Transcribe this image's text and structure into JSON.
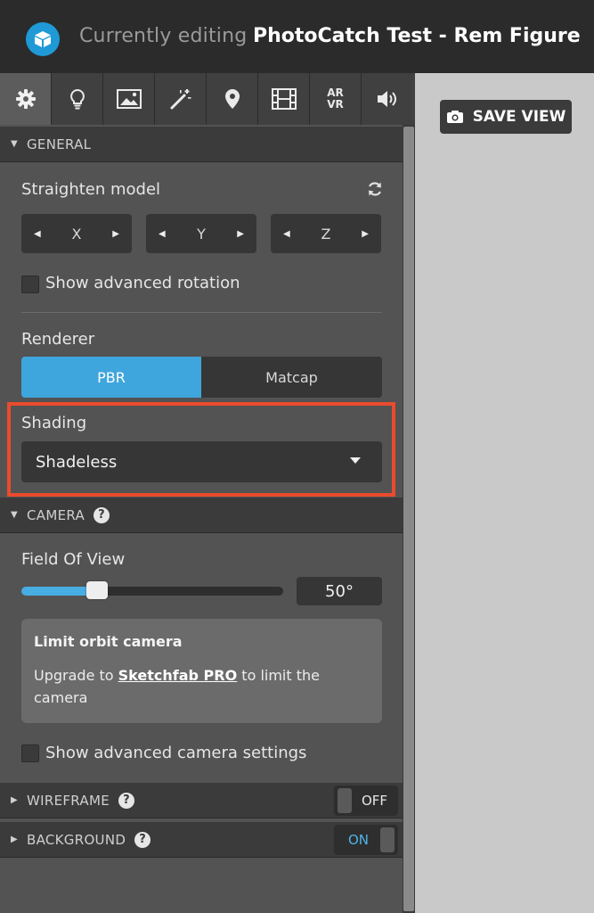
{
  "header": {
    "editing_label": "Currently editing",
    "model_title": "PhotoCatch Test - Rem Figure",
    "logo_icon": "cube-icon"
  },
  "tabs": [
    {
      "icon": "gear-icon",
      "active": true
    },
    {
      "icon": "lightbulb-icon"
    },
    {
      "icon": "image-icon"
    },
    {
      "icon": "magic-wand-icon"
    },
    {
      "icon": "map-pin-icon"
    },
    {
      "icon": "film-icon"
    },
    {
      "label_top": "AR",
      "label_bottom": "VR"
    },
    {
      "icon": "speaker-icon"
    }
  ],
  "general": {
    "section_label": "GENERAL",
    "straighten_label": "Straighten model",
    "axes": [
      "X",
      "Y",
      "Z"
    ],
    "advanced_rotation_label": "Show advanced rotation",
    "renderer_label": "Renderer",
    "renderer_options": [
      "PBR",
      "Matcap"
    ],
    "renderer_selected": "PBR",
    "shading_label": "Shading",
    "shading_value": "Shadeless"
  },
  "camera": {
    "section_label": "CAMERA",
    "fov_label": "Field Of View",
    "fov_value": "50°",
    "fov_slider_fraction": 0.29,
    "orbit_title": "Limit orbit camera",
    "orbit_text_prefix": "Upgrade to",
    "orbit_link": "Sketchfab PRO",
    "orbit_text_suffix": "to limit the camera",
    "advanced_camera_label": "Show advanced camera settings"
  },
  "wireframe": {
    "section_label": "WIREFRAME",
    "toggle_state": "OFF"
  },
  "background": {
    "section_label": "BACKGROUND",
    "toggle_state": "ON"
  },
  "viewer": {
    "save_view_label": "SAVE VIEW"
  },
  "colors": {
    "accent": "#3fa6dd",
    "highlight_border": "#ea4b2d",
    "on_text": "#4fb3e8"
  }
}
